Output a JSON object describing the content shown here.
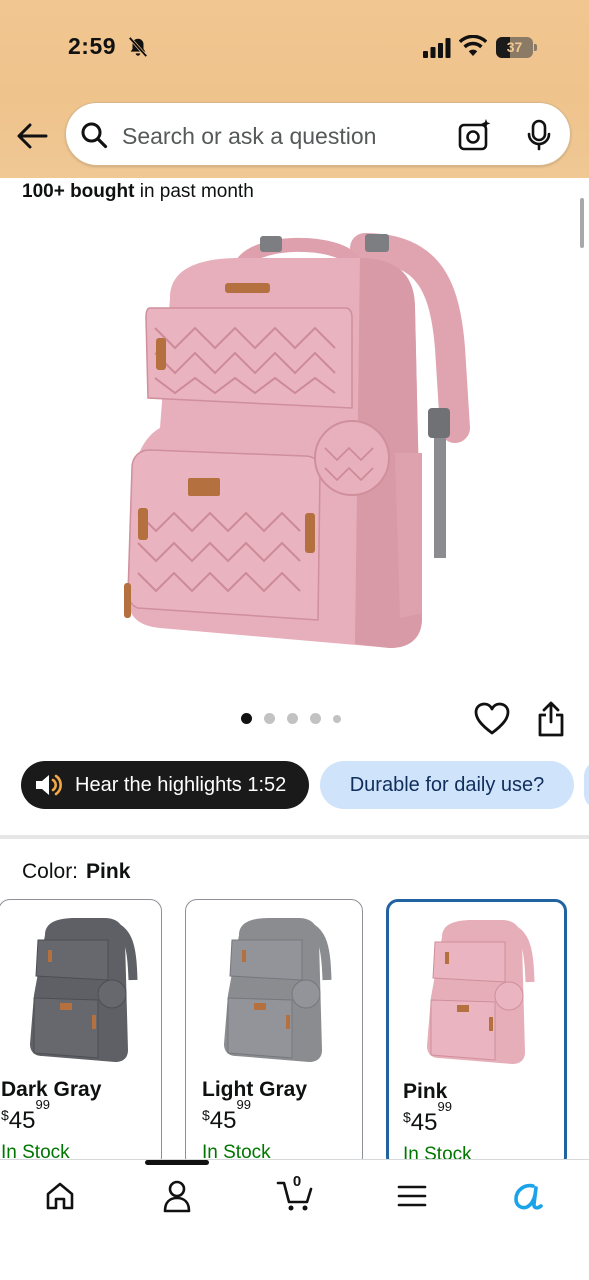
{
  "status_bar": {
    "time": "2:59",
    "battery": "37"
  },
  "search": {
    "placeholder": "Search or ask a question"
  },
  "product": {
    "bought_bold": "100+ bought",
    "bought_rest": " in past month",
    "image_count": 5,
    "active_image_index": 0
  },
  "chips": {
    "highlights": "Hear the highlights 1:52",
    "question": "Durable for daily use?"
  },
  "color": {
    "label": "Color:",
    "selected": "Pink"
  },
  "swatches": [
    {
      "name": "Dark Gray",
      "currency": "$",
      "price_whole": "45",
      "price_fraction": "99",
      "stock": "In Stock",
      "color": "#5e6066"
    },
    {
      "name": "Light Gray",
      "currency": "$",
      "price_whole": "45",
      "price_fraction": "99",
      "stock": "In Stock",
      "color": "#8a8c90"
    },
    {
      "name": "Pink",
      "currency": "$",
      "price_whole": "45",
      "price_fraction": "99",
      "stock": "In Stock",
      "color": "#e6aeb9"
    }
  ],
  "nav": {
    "cart_count": "0",
    "items": [
      "home-icon",
      "profile-icon",
      "cart-icon",
      "menu-icon",
      "rufus-icon"
    ]
  },
  "colors": {
    "header_bg": "#efc38c",
    "accent_blue": "#2162a1",
    "in_stock_green": "#007600",
    "product_pink": "#e6aeb9",
    "chip_light": "#cfe3fb"
  }
}
